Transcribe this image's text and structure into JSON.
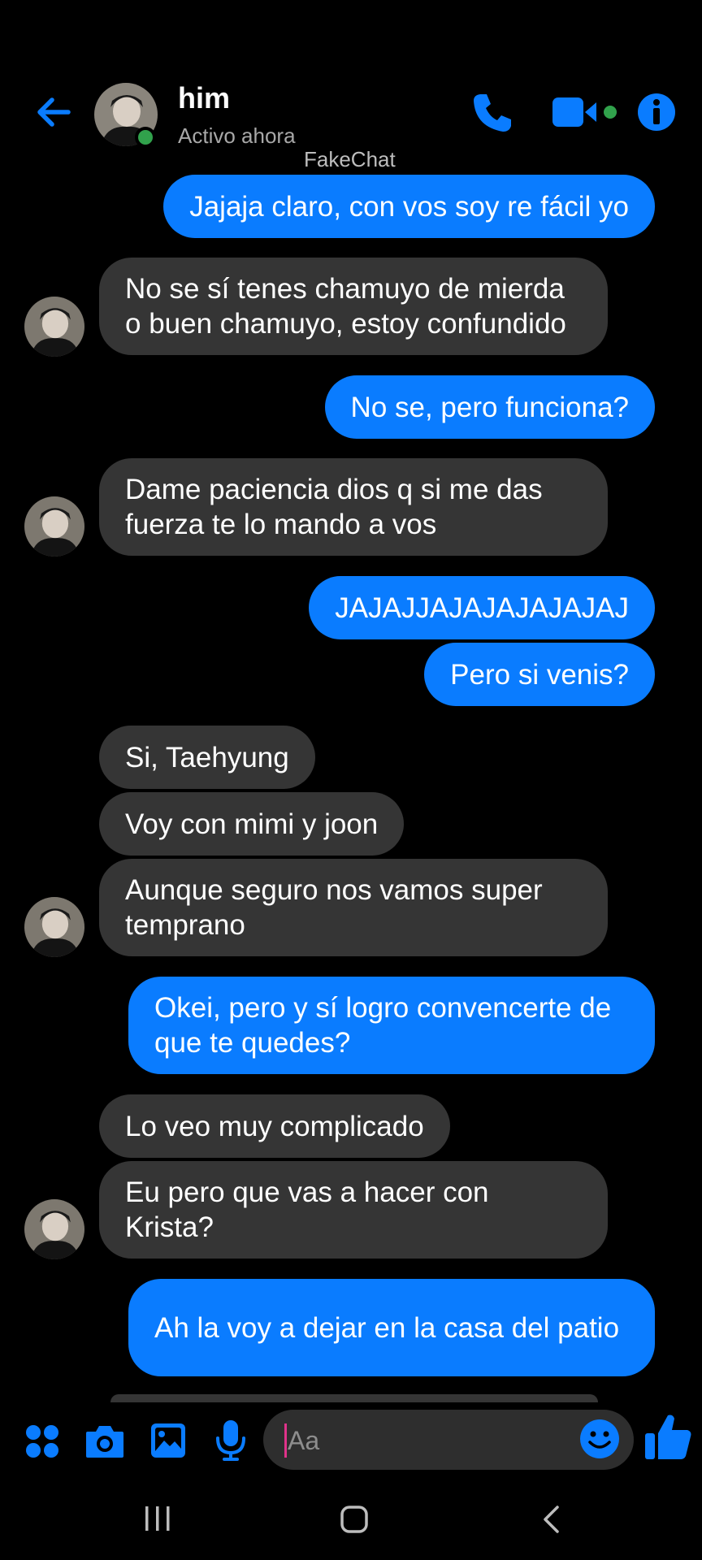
{
  "header": {
    "name": "him",
    "status": "Activo ahora",
    "watermark": "FakeChat"
  },
  "colors": {
    "accent": "#0a7cff",
    "incoming_bubble": "#353535",
    "online": "#31a24c",
    "background": "#000000"
  },
  "messages": [
    {
      "dir": "out",
      "text": "Jajaja claro, con vos soy re fácil yo"
    },
    {
      "dir": "in",
      "text": "No se sí tenes chamuyo de mierda o buen chamuyo, estoy confundido"
    },
    {
      "dir": "out",
      "text": "No se, pero funciona?"
    },
    {
      "dir": "in",
      "text": "Dame paciencia dios q si me das fuerza te lo mando a vos"
    },
    {
      "dir": "out",
      "text": "JAJAJJAJAJAJAJAJAJ"
    },
    {
      "dir": "out",
      "text": "Pero si venis?"
    },
    {
      "dir": "in",
      "text": "Si, Taehyung"
    },
    {
      "dir": "in",
      "text": "Voy con mimi y joon"
    },
    {
      "dir": "in",
      "text": "Aunque seguro nos vamos super temprano"
    },
    {
      "dir": "out",
      "text": "Okei, pero y sí logro convencerte de que te quedes?"
    },
    {
      "dir": "in",
      "text": "Lo veo muy complicado"
    },
    {
      "dir": "in",
      "text": "Eu pero que vas a hacer con Krista?"
    },
    {
      "dir": "out",
      "text": "Ah la voy a dejar en la casa del patio"
    }
  ],
  "composer": {
    "placeholder": "Aa"
  },
  "icons": {
    "back": "back-arrow-icon",
    "call": "phone-icon",
    "video": "video-camera-icon",
    "info": "info-icon",
    "menu": "four-dots-icon",
    "camera": "camera-icon",
    "gallery": "image-icon",
    "mic": "microphone-icon",
    "emoji": "emoji-icon",
    "like": "thumbs-up-icon"
  }
}
